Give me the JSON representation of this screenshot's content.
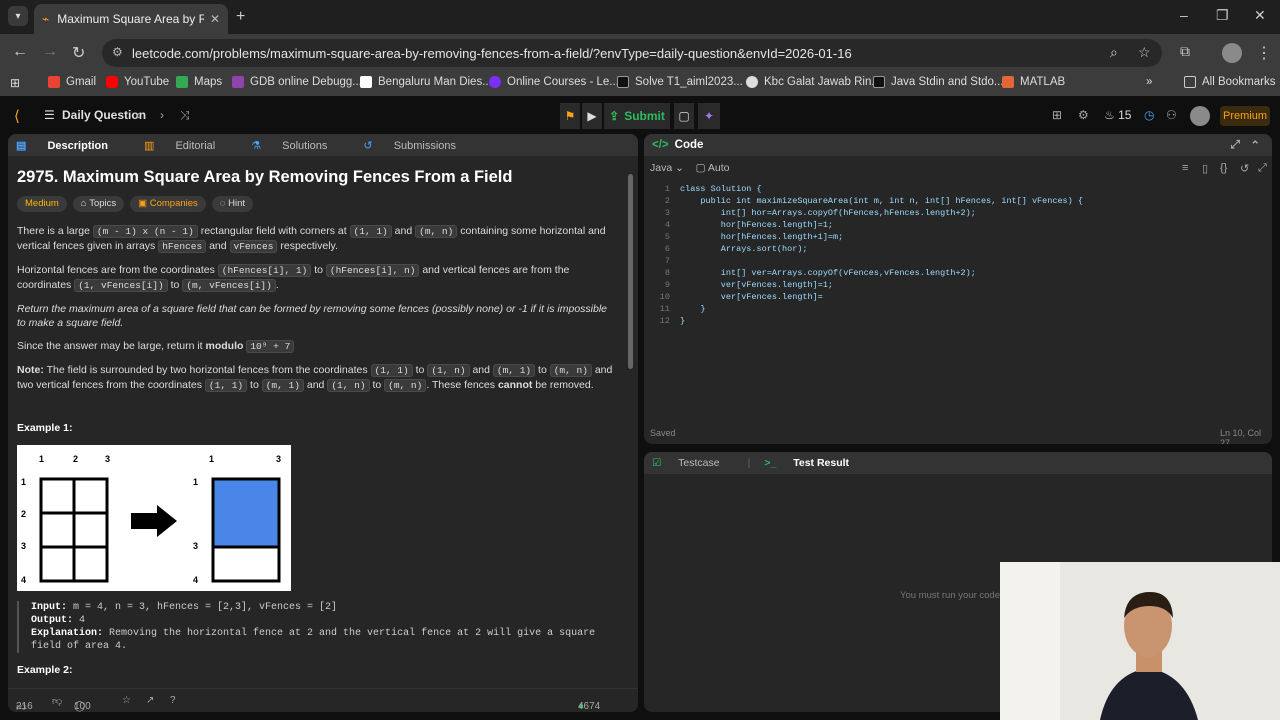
{
  "browser": {
    "tab_title": "Maximum Square Area by Remo",
    "url": "leetcode.com/problems/maximum-square-area-by-removing-fences-from-a-field/?envType=daily-question&envId=2026-01-16",
    "bookmarks": [
      "Gmail",
      "YouTube",
      "Maps",
      "GDB online Debugg...",
      "Bengaluru Man Dies...",
      "Online Courses - Le...",
      "Solve T1_aiml2023...",
      "Kbc Galat Jawab Rin...",
      "Java Stdin and Stdo...",
      "MATLAB"
    ],
    "all_bookmarks": "All Bookmarks"
  },
  "lc_header": {
    "daily_question": "Daily Question",
    "submit_label": "Submit",
    "streak": "15",
    "premium": "Premium"
  },
  "left_tabs": [
    "Description",
    "Editorial",
    "Solutions",
    "Submissions"
  ],
  "problem": {
    "title": "2975. Maximum Square Area by Removing Fences From a Field",
    "difficulty": "Medium",
    "chips": [
      "Topics",
      "Companies",
      "Hint"
    ],
    "p1a": "There is a large ",
    "p1_code1": "(m - 1) x (n - 1)",
    "p1b": " rectangular field with corners at ",
    "p1_code2": "(1, 1)",
    "p1c": " and ",
    "p1_code3": "(m, n)",
    "p1d": " containing some horizontal and vertical fences given in arrays ",
    "p1_code4": "hFences",
    "p1e": " and ",
    "p1_code5": "vFences",
    "p1f": " respectively.",
    "p2a": "Horizontal fences are from the coordinates ",
    "p2_code1": "(hFences[i], 1)",
    "p2b": " to ",
    "p2_code2": "(hFences[i], n)",
    "p2c": " and vertical fences are from the coordinates ",
    "p2_code3": "(1, vFences[i])",
    "p2d": " to ",
    "p2_code4": "(m, vFences[i])",
    "p2e": ".",
    "p3": "Return the maximum area of a square field that can be formed by removing some fences (possibly none) or -1 if it is impossible to make a square field.",
    "p4a": "Since the answer may be large, return it ",
    "p4b": "modulo",
    "p4_code": "10⁹ + 7",
    "p5a": "Note:",
    "p5b": " The field is surrounded by two horizontal fences from the coordinates ",
    "p5_c1": "(1, 1)",
    "p5c": " to ",
    "p5_c2": "(1, n)",
    "p5d": " and ",
    "p5_c3": "(m, 1)",
    "p5e": " to ",
    "p5_c4": "(m, n)",
    "p5f": " and two vertical fences from the coordinates ",
    "p5_c5": "(1, 1)",
    "p5g": " to ",
    "p5_c6": "(m, 1)",
    "p5h": " and ",
    "p5_c7": "(1, n)",
    "p5i": " to ",
    "p5_c8": "(m, n)",
    "p5j": ". These fences ",
    "p5k": "cannot",
    "p5l": " be removed.",
    "example_heading": "Example 1:",
    "ex_input_label": "Input:",
    "ex_input": " m = 4, n = 3, hFences = [2,3], vFences = [2]",
    "ex_output_label": "Output:",
    "ex_output": " 4",
    "ex_expl_label": "Explanation:",
    "ex_expl": " Removing the horizontal fence at 2 and the vertical fence at 2 will give a square field of area 4.",
    "example2_heading": "Example 2:",
    "diagram_left_cols": [
      "1",
      "2",
      "3"
    ],
    "diagram_right_cols": [
      "1",
      "3"
    ],
    "diagram_rows": [
      "1",
      "2",
      "3",
      "4"
    ],
    "diagram_right_rows": [
      "1",
      "3",
      "4"
    ]
  },
  "left_footer": {
    "likes": "216",
    "comments": "100",
    "online": "4674 Online"
  },
  "code_panel": {
    "title": "Code",
    "language": "Java",
    "mode": "Auto",
    "lines": [
      "class Solution {",
      "    public int maximizeSquareArea(int m, int n, int[] hFences, int[] vFences) {",
      "        int[] hor=Arrays.copyOf(hFences,hFences.length+2);",
      "        hor[hFences.length]=1;",
      "        hor[hFences.length+1]=m;",
      "        Arrays.sort(hor);",
      "",
      "        int[] ver=Arrays.copyOf(vFences,vFences.length+2);",
      "        ver[vFences.length]=1;",
      "        ver[vFences.length]=",
      "    }",
      "}"
    ],
    "saved": "Saved",
    "cursor": "Ln 10, Col 27"
  },
  "test_panel": {
    "tabs": [
      "Testcase",
      "Test Result"
    ],
    "hint": "You must run your code first"
  }
}
